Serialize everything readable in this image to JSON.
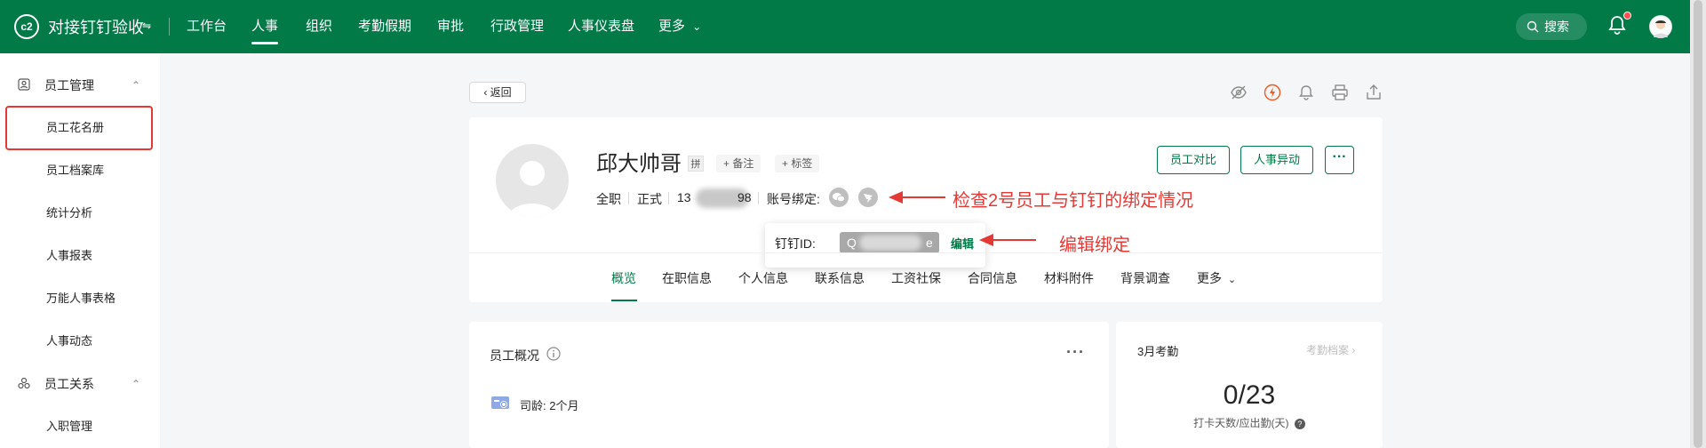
{
  "topbar": {
    "logo_text": "c2",
    "app_name": "对接钉钉验收",
    "nav": [
      "工作台",
      "人事",
      "组织",
      "考勤假期",
      "审批",
      "行政管理",
      "人事仪表盘",
      "更多"
    ],
    "active_nav": "人事",
    "search_label": "搜索",
    "bg_color": "#017a48"
  },
  "sidebar": {
    "groups": [
      {
        "label": "员工管理",
        "icon": "person-card-icon",
        "items": [
          "员工花名册",
          "员工档案库",
          "统计分析",
          "人事报表",
          "万能人事表格",
          "人事动态"
        ]
      },
      {
        "label": "员工关系",
        "icon": "relation-icon",
        "items": [
          "入职管理"
        ]
      }
    ],
    "highlighted_item": "员工花名册"
  },
  "main": {
    "back_label": "返回",
    "toolbar_icons": [
      "eye-hidden-icon",
      "lightning-icon",
      "bell-icon",
      "print-icon",
      "share-icon"
    ],
    "profile": {
      "name": "邱大帅哥",
      "pin_label": "拼",
      "chip_note": "+ 备注",
      "chip_tag": "+ 标签",
      "employment_type": "全职",
      "status": "正式",
      "phone_prefix": "13",
      "phone_suffix": "98",
      "account_binding_label": "账号绑定:",
      "buttons": [
        "员工对比",
        "人事异动"
      ],
      "more_label": "···"
    },
    "popover": {
      "label": "钉钉ID:",
      "id_prefix": "Q",
      "id_suffix": "e",
      "edit_label": "编辑"
    },
    "annotations": {
      "check_binding": "检查2号员工与钉钉的绑定情况",
      "edit_binding": "编辑绑定"
    },
    "tabs": [
      "概览",
      "在职信息",
      "个人信息",
      "联系信息",
      "工资社保",
      "合同信息",
      "材料附件",
      "背景调查",
      "更多"
    ],
    "active_tab": "概览",
    "overview": {
      "title": "员工概况",
      "more": "···",
      "seniority_label": "司龄:",
      "seniority_value": "2个月"
    },
    "attendance": {
      "title": "3月考勤",
      "link": "考勤档案",
      "value": "0/23",
      "caption": "打卡天数/应出勤(天)"
    }
  }
}
